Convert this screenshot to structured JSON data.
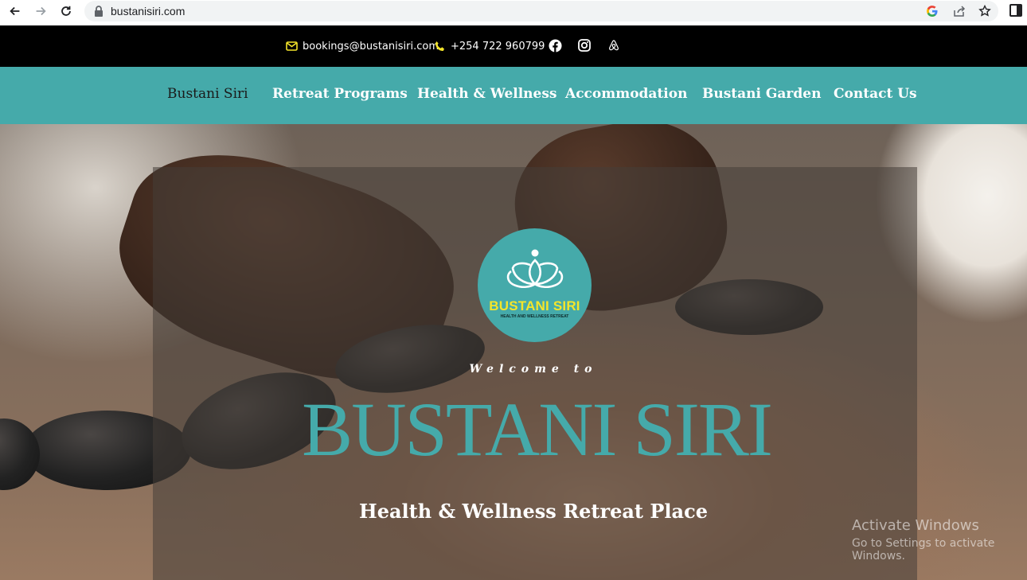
{
  "browser": {
    "url": "bustanisiri.com"
  },
  "topbar": {
    "email": "bookings@bustanisiri.com",
    "phone": "+254 722 960799",
    "social_icons": [
      "facebook-icon",
      "instagram-icon",
      "airbnb-icon"
    ]
  },
  "nav": {
    "items": [
      {
        "label": "Bustani Siri",
        "active": true
      },
      {
        "label": "Retreat Programs"
      },
      {
        "label": "Health & Wellness"
      },
      {
        "label": "Accommodation"
      },
      {
        "label": "Bustani Garden"
      },
      {
        "label": "Contact Us"
      }
    ]
  },
  "logo": {
    "brand": "BUSTANI SIRI",
    "tagline": "HEALTH AND WELLNESS RETREAT"
  },
  "hero": {
    "welcome": "Welcome to",
    "title": "BUSTANI SIRI",
    "subtitle": "Health & Wellness Retreat Place"
  },
  "watermark": {
    "line1": "Activate Windows",
    "line2": "Go to Settings to activate Windows."
  },
  "colors": {
    "accent": "#45aaaa",
    "topbar": "#000000",
    "logo_text": "#f4e52a"
  }
}
